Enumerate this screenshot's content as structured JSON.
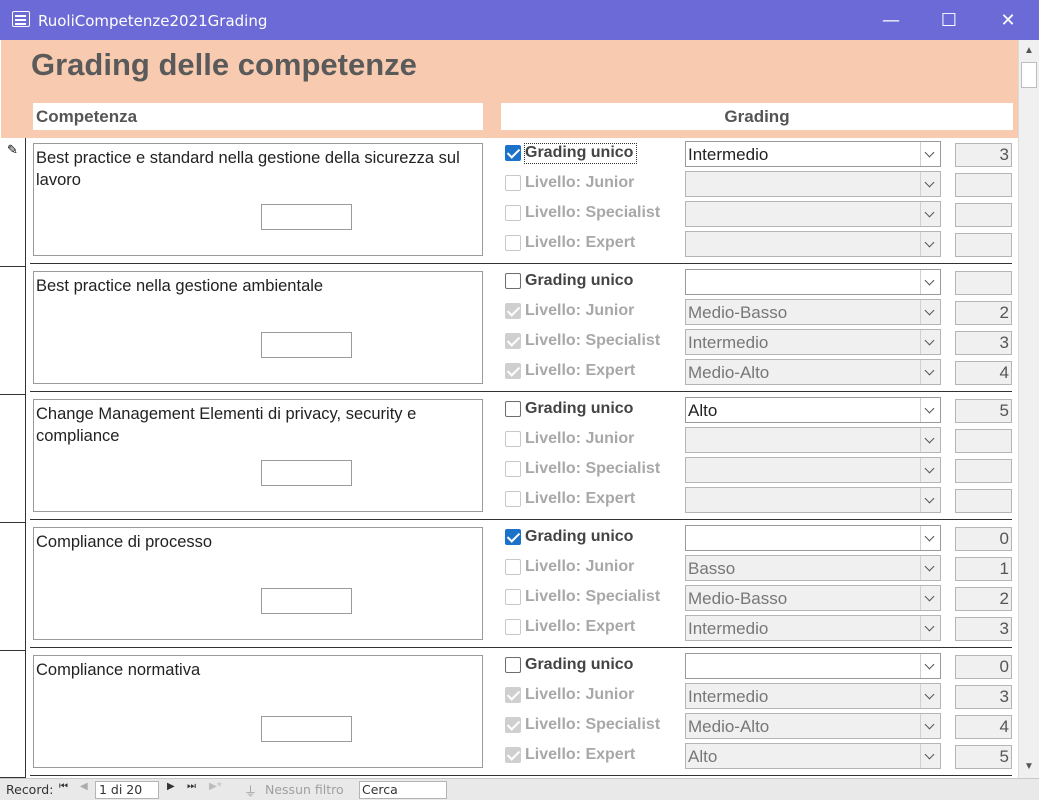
{
  "window": {
    "title": "RuoliCompetenze2021Grading",
    "min_glyph": "—",
    "max_glyph": "☐",
    "close_glyph": "✕"
  },
  "form": {
    "title": "Grading delle competenze",
    "col_competenza": "Competenza",
    "col_grading": "Grading"
  },
  "records": [
    {
      "competenza": "Best practice e standard nella gestione della sicurezza sul lavoro",
      "rows": [
        {
          "label": "Grading unico",
          "checked": true,
          "enabled": true,
          "value": "Intermedio",
          "number": "3"
        },
        {
          "label": "Livello: Junior",
          "checked": false,
          "enabled": false,
          "value": "",
          "number": ""
        },
        {
          "label": "Livello: Specialist",
          "checked": false,
          "enabled": false,
          "value": "",
          "number": ""
        },
        {
          "label": "Livello: Expert",
          "checked": false,
          "enabled": false,
          "value": "",
          "number": ""
        }
      ]
    },
    {
      "competenza": "Best practice nella gestione ambientale",
      "rows": [
        {
          "label": "Grading unico",
          "checked": false,
          "enabled": true,
          "value": "",
          "number": ""
        },
        {
          "label": "Livello: Junior",
          "checked": true,
          "enabled": false,
          "value": "Medio-Basso",
          "number": "2"
        },
        {
          "label": "Livello: Specialist",
          "checked": true,
          "enabled": false,
          "value": "Intermedio",
          "number": "3"
        },
        {
          "label": "Livello: Expert",
          "checked": true,
          "enabled": false,
          "value": "Medio-Alto",
          "number": "4"
        }
      ]
    },
    {
      "competenza": "Change Management Elementi di privacy, security e compliance",
      "rows": [
        {
          "label": "Grading unico",
          "checked": false,
          "enabled": true,
          "value": "Alto",
          "number": "5"
        },
        {
          "label": "Livello: Junior",
          "checked": false,
          "enabled": false,
          "value": "",
          "number": ""
        },
        {
          "label": "Livello: Specialist",
          "checked": false,
          "enabled": false,
          "value": "",
          "number": ""
        },
        {
          "label": "Livello: Expert",
          "checked": false,
          "enabled": false,
          "value": "",
          "number": ""
        }
      ]
    },
    {
      "competenza": "Compliance di processo",
      "rows": [
        {
          "label": "Grading unico",
          "checked": true,
          "enabled": true,
          "value": "",
          "number": "0"
        },
        {
          "label": "Livello: Junior",
          "checked": false,
          "enabled": false,
          "value": "Basso",
          "number": "1"
        },
        {
          "label": "Livello: Specialist",
          "checked": false,
          "enabled": false,
          "value": "Medio-Basso",
          "number": "2"
        },
        {
          "label": "Livello: Expert",
          "checked": false,
          "enabled": false,
          "value": "Intermedio",
          "number": "3"
        }
      ]
    },
    {
      "competenza": "Compliance normativa",
      "rows": [
        {
          "label": "Grading unico",
          "checked": false,
          "enabled": true,
          "value": "",
          "number": "0"
        },
        {
          "label": "Livello: Junior",
          "checked": true,
          "enabled": false,
          "value": "Intermedio",
          "number": "3"
        },
        {
          "label": "Livello: Specialist",
          "checked": true,
          "enabled": false,
          "value": "Medio-Alto",
          "number": "4"
        },
        {
          "label": "Livello: Expert",
          "checked": true,
          "enabled": false,
          "value": "Alto",
          "number": "5"
        }
      ]
    }
  ],
  "statusbar": {
    "record_label": "Record:",
    "record_position": "1 di 20",
    "filter_label": "Nessun filtro",
    "search_placeholder": "Cerca"
  },
  "colors": {
    "titlebar": "#6b6ad6",
    "header_band": "#f8cbb0",
    "checkbox_checked": "#1a73c9"
  }
}
